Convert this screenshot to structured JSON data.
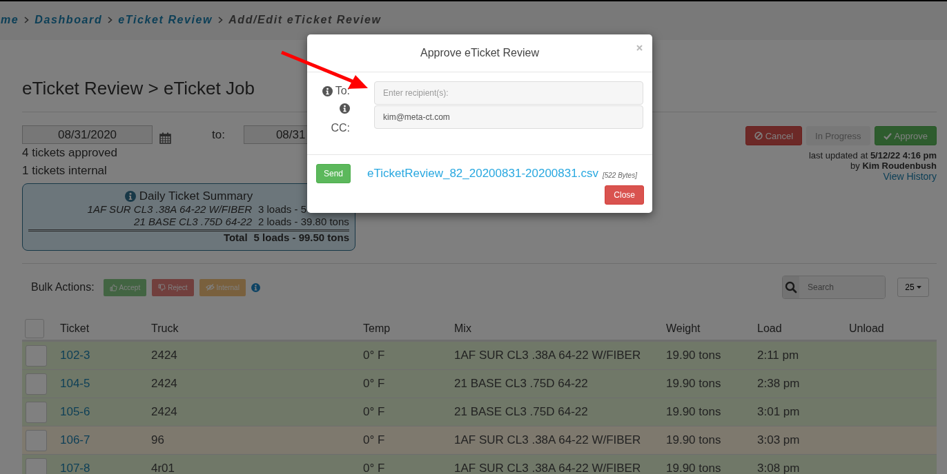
{
  "breadcrumb": [
    {
      "label": "me",
      "current": false
    },
    {
      "label": "Dashboard",
      "current": false
    },
    {
      "label": "eTicket Review",
      "current": false
    },
    {
      "label": "Add/Edit eTicket Review",
      "current": true
    }
  ],
  "page_title": "eTicket Review > eTicket Job",
  "date_range": {
    "from": "08/31/2020",
    "to_label": "to:",
    "to": "08/31"
  },
  "stats": [
    "4 tickets approved",
    "1 tickets internal"
  ],
  "summary": {
    "title": "Daily Ticket Summary",
    "rows": [
      {
        "mix": "1AF SUR CL3 .38A 64-22 W/FIBER",
        "loads": "3 loads - 5"
      },
      {
        "mix": "21 BASE CL3 .75D 64-22",
        "loads": "2 loads - 39.80 tons"
      }
    ],
    "total_label": "Total",
    "total": "5 loads - 99.50 tons"
  },
  "status_buttons": [
    {
      "label": "Cancel",
      "kind": "cancel",
      "disabled": false
    },
    {
      "label": "In Progress",
      "kind": "progress",
      "disabled": true
    },
    {
      "label": "Approve",
      "kind": "approve",
      "disabled": false
    }
  ],
  "last_updated": "last updated at **5/12/22 4:16 pm**",
  "updated_by": "by **Kim Roudenbush**",
  "history_link": "View History",
  "bulk_actions": {
    "label": "Bulk Actions:",
    "buttons": [
      {
        "label": "Accept",
        "kind": "accept",
        "disabled": true
      },
      {
        "label": "Reject",
        "kind": "reject",
        "disabled": true
      },
      {
        "label": "Internal",
        "kind": "internal",
        "disabled": true
      }
    ]
  },
  "search": {
    "placeholder": "Search"
  },
  "page_size": "25",
  "table": {
    "select_all_checked": false,
    "columns": [
      "Ticket",
      "Truck",
      "Temp",
      "Mix",
      "Weight",
      "Load",
      "Unload"
    ],
    "rows": [
      {
        "color": "#707868",
        "checked": false,
        "cells": [
          "102-3",
          "2424",
          "0° F",
          "1AF SUR CL3 .38A 64-22 W/FIBER",
          "19.90 tons",
          "2:11 pm"
        ]
      },
      {
        "color": "#707868",
        "checked": false,
        "cells": [
          "104-5",
          "2424",
          "0° F",
          "21 BASE CL3 .75D 64-22",
          "19.90 tons",
          "2:38 pm"
        ]
      },
      {
        "color": "#707868",
        "checked": false,
        "cells": [
          "105-6",
          "2424",
          "0° F",
          "21 BASE CL3 .75D 64-22",
          "19.90 tons",
          "3:01 pm"
        ]
      },
      {
        "color": "#7e796e",
        "checked": false,
        "cells": [
          "106-7",
          "96",
          "0° F",
          "1AF SUR CL3 .38A 64-22 W/FIBER",
          "19.90 tons",
          "3:03 pm"
        ]
      },
      {
        "color": "#707868",
        "checked": false,
        "cells": [
          "107-8",
          "4r01",
          "0° F",
          "1AF SUR CL3 .38A 64-22 W/FIBER",
          "19.90 tons",
          "3:08 pm"
        ]
      }
    ]
  },
  "modal": {
    "title": "Approve eTicket Review",
    "to_label": "To:",
    "to_placeholder": "Enter recipient(s):",
    "cc_label": "CC:",
    "cc_value": "kim@meta-ct.com",
    "send": "Send",
    "file_link": "eTicketReview_82_20200831-20200831.csv",
    "file_size": "[522 Bytes]",
    "close": "Close"
  }
}
